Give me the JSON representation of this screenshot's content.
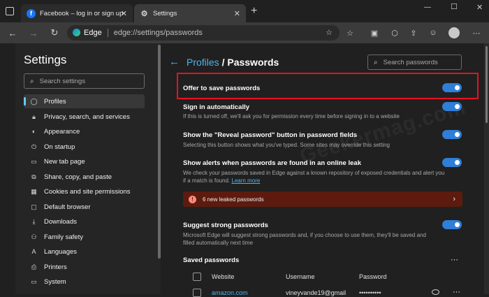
{
  "tabs": [
    {
      "title": "Facebook – log in or sign up",
      "favicon": "facebook-icon",
      "active": false
    },
    {
      "title": "Settings",
      "favicon": "gear-icon",
      "active": true
    }
  ],
  "new_tab_label": "+",
  "window_controls": {
    "minimize": "—",
    "maximize": "☐",
    "close": "✕"
  },
  "address": {
    "brand": "Edge",
    "url": "edge://settings/passwords"
  },
  "sidebar": {
    "title": "Settings",
    "search_placeholder": "Search settings",
    "items": [
      {
        "label": "Profiles",
        "icon": "profile-icon",
        "active": true
      },
      {
        "label": "Privacy, search, and services",
        "icon": "lock-icon"
      },
      {
        "label": "Appearance",
        "icon": "appearance-icon"
      },
      {
        "label": "On startup",
        "icon": "power-icon"
      },
      {
        "label": "New tab page",
        "icon": "newtab-icon"
      },
      {
        "label": "Share, copy, and paste",
        "icon": "share-icon"
      },
      {
        "label": "Cookies and site permissions",
        "icon": "cookie-icon"
      },
      {
        "label": "Default browser",
        "icon": "browser-icon"
      },
      {
        "label": "Downloads",
        "icon": "download-icon"
      },
      {
        "label": "Family safety",
        "icon": "family-icon"
      },
      {
        "label": "Languages",
        "icon": "language-icon"
      },
      {
        "label": "Printers",
        "icon": "printer-icon"
      },
      {
        "label": "System",
        "icon": "system-icon"
      }
    ]
  },
  "header": {
    "link": "Profiles",
    "separator": " / ",
    "current": "Passwords",
    "search_placeholder": "Search passwords"
  },
  "settings": {
    "offer_save": {
      "title": "Offer to save passwords",
      "on": true
    },
    "sign_in": {
      "title": "Sign in automatically",
      "desc": "If this is turned off, we'll ask you for permission every time before signing in to a website",
      "on": true
    },
    "reveal": {
      "title": "Show the \"Reveal password\" button in password fields",
      "desc": "Selecting this button shows what you've typed. Some sites may override this setting",
      "on": true
    },
    "alerts": {
      "title": "Show alerts when passwords are found in an online leak",
      "desc": "We check your passwords saved in Edge against a known repository of exposed credentials and alert you if a match is found.",
      "learn_more": "Learn more",
      "on": true
    },
    "leak_banner": "6 new leaked passwords",
    "strong": {
      "title": "Suggest strong passwords",
      "desc": "Microsoft Edge will suggest strong passwords and, if you choose to use them, they'll be saved and filled automatically next time",
      "on": true
    }
  },
  "saved": {
    "title": "Saved passwords",
    "columns": [
      "Website",
      "Username",
      "Password"
    ],
    "row": {
      "website": "amazon.com",
      "username": "vineyvande19@gmail",
      "password": "••••••••••"
    }
  },
  "watermark": "Geekermag.com",
  "colors": {
    "accent": "#2f7ed8",
    "link": "#4fb3f0",
    "highlight": "#e81123",
    "leak_bg": "#5c1b0e"
  }
}
